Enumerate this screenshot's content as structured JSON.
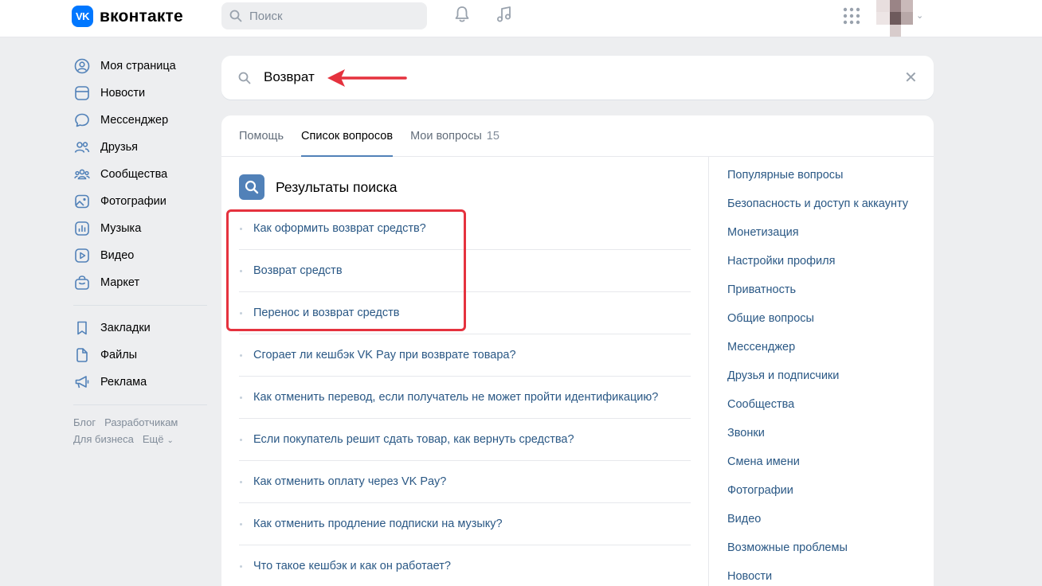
{
  "header": {
    "logo_mark": "VK",
    "logo_text": "вконтакте",
    "search_placeholder": "Поиск",
    "icons": [
      "bell-icon",
      "music-icon",
      "apps-grid-icon",
      "chevron-down-icon"
    ]
  },
  "sidebar": {
    "items": [
      {
        "label": "Моя страница",
        "icon": "user-circle-icon"
      },
      {
        "label": "Новости",
        "icon": "news-icon"
      },
      {
        "label": "Мессенджер",
        "icon": "message-icon"
      },
      {
        "label": "Друзья",
        "icon": "friends-icon"
      },
      {
        "label": "Сообщества",
        "icon": "communities-icon"
      },
      {
        "label": "Фотографии",
        "icon": "photo-icon"
      },
      {
        "label": "Музыка",
        "icon": "music-icon"
      },
      {
        "label": "Видео",
        "icon": "video-icon"
      },
      {
        "label": "Маркет",
        "icon": "market-icon"
      }
    ],
    "items2": [
      {
        "label": "Закладки",
        "icon": "bookmark-icon"
      },
      {
        "label": "Файлы",
        "icon": "file-icon"
      },
      {
        "label": "Реклама",
        "icon": "megaphone-icon"
      }
    ],
    "footer": {
      "blog": "Блог",
      "developers": "Разработчикам",
      "business": "Для бизнеса",
      "more": "Ещё"
    }
  },
  "search": {
    "query": "Возврат"
  },
  "tabs": [
    {
      "label": "Помощь"
    },
    {
      "label": "Список вопросов"
    },
    {
      "label": "Мои вопросы",
      "count": "15"
    }
  ],
  "results": {
    "title": "Результаты поиска",
    "questions": [
      "Как оформить возврат средств?",
      "Возврат средств",
      "Перенос и возврат средств",
      "Сгорает ли кешбэк VK Pay при возврате товара?",
      "Как отменить перевод, если получатель не может пройти идентификацию?",
      "Если покупатель решит сдать товар, как вернуть средства?",
      "Как отменить оплату через VK Pay?",
      "Как отменить продление подписки на музыку?",
      "Что такое кешбэк и как он работает?"
    ]
  },
  "categories": [
    "Популярные вопросы",
    "Безопасность и доступ к аккаунту",
    "Монетизация",
    "Настройки профиля",
    "Приватность",
    "Общие вопросы",
    "Мессенджер",
    "Друзья и подписчики",
    "Сообщества",
    "Звонки",
    "Смена имени",
    "Фотографии",
    "Видео",
    "Возможные проблемы",
    "Новости"
  ],
  "colors": {
    "accent": "#5181b8",
    "link": "#2a5885",
    "annotation": "#e5323e",
    "brand": "#0077ff"
  }
}
